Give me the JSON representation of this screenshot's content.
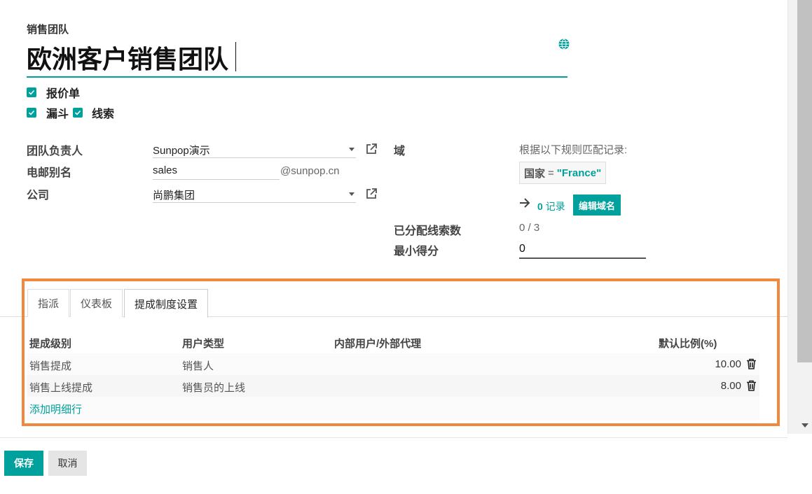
{
  "header": {
    "team_label": "销售团队",
    "team_name": "欧洲客户销售团队"
  },
  "checkboxes": {
    "quotations": "报价单",
    "pipeline": "漏斗",
    "leads": "线索"
  },
  "fields": {
    "leader_label": "团队负责人",
    "leader_value": "Sunpop演示",
    "alias_label": "电邮别名",
    "alias_value": "sales",
    "alias_domain": "@sunpop.cn",
    "company_label": "公司",
    "company_value": "尚鹏集团"
  },
  "domain": {
    "label": "域",
    "rule_text": "根据以下规则匹配记录:",
    "field": "国家",
    "operator": "=",
    "value": "\"France\"",
    "records_count": "0",
    "records_label": "记录",
    "edit_button": "编辑域名"
  },
  "assignment": {
    "assigned_label": "已分配线索数",
    "assigned_value": "0 / 3",
    "min_score_label": "最小得分",
    "min_score_value": "0"
  },
  "tabs": [
    {
      "label": "指派"
    },
    {
      "label": "仪表板"
    },
    {
      "label": "提成制度设置"
    }
  ],
  "table": {
    "headers": [
      "提成级别",
      "用户类型",
      "内部用户/外部代理",
      "默认比例(%)"
    ],
    "rows": [
      {
        "level": "销售提成",
        "user_type": "销售人",
        "agent": "",
        "ratio": "10.00"
      },
      {
        "level": "销售上线提成",
        "user_type": "销售员的上线",
        "agent": "",
        "ratio": "8.00"
      }
    ],
    "add_line": "添加明细行"
  },
  "footer": {
    "save": "保存",
    "cancel": "取消"
  },
  "colors": {
    "accent": "#00a09d",
    "highlight_border": "#f0883e"
  },
  "icons": {
    "globe": "globe-icon",
    "external": "external-link-icon",
    "arrow": "arrow-right-icon",
    "trash": "trash-icon"
  }
}
